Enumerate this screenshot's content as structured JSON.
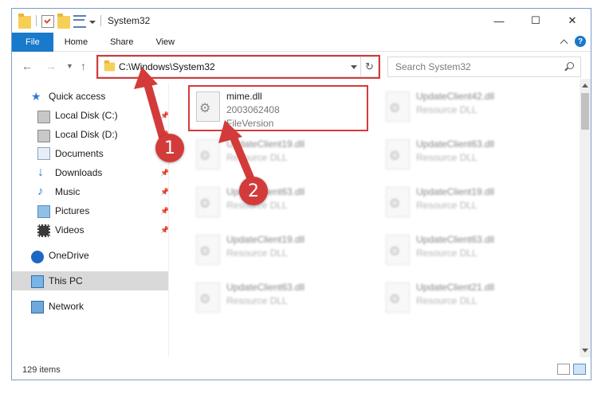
{
  "window": {
    "title": "System32",
    "controls": {
      "minimize": "—",
      "maximize": "☐",
      "close": "✕"
    }
  },
  "ribbon": {
    "tabs": [
      "File",
      "Home",
      "Share",
      "View"
    ],
    "help": "?"
  },
  "address": {
    "path": "C:\\Windows\\System32",
    "refresh_icon": "↻"
  },
  "search": {
    "placeholder": "Search System32"
  },
  "nav": {
    "items": [
      {
        "label": "Quick access",
        "icon": "star-icon",
        "pinned": false
      },
      {
        "label": "Local Disk (C:)",
        "icon": "disk-icon",
        "pinned": true
      },
      {
        "label": "Local Disk (D:)",
        "icon": "disk-icon",
        "pinned": true
      },
      {
        "label": "Documents",
        "icon": "document-icon",
        "pinned": true
      },
      {
        "label": "Downloads",
        "icon": "download-icon",
        "pinned": true
      },
      {
        "label": "Music",
        "icon": "music-icon",
        "pinned": true
      },
      {
        "label": "Pictures",
        "icon": "pictures-icon",
        "pinned": true
      },
      {
        "label": "Videos",
        "icon": "video-icon",
        "pinned": true
      },
      {
        "label": "OneDrive",
        "icon": "cloud-icon",
        "pinned": false
      },
      {
        "label": "This PC",
        "icon": "computer-icon",
        "pinned": false,
        "selected": true
      },
      {
        "label": "Network",
        "icon": "network-icon",
        "pinned": false
      }
    ]
  },
  "files": [
    {
      "name": "mime.dll",
      "line2": "2003062408",
      "line3": "FileVersion",
      "highlighted": true
    },
    {
      "name": "UpdateClient42.dll",
      "line2": "Resource DLL"
    },
    {
      "name": "UpdateClient19.dll",
      "line2": "Resource DLL"
    },
    {
      "name": "UpdateClient63.dll",
      "line2": "Resource DLL"
    },
    {
      "name": "UpdateClient63.dll",
      "line2": "Resource DLL"
    },
    {
      "name": "UpdateClient19.dll",
      "line2": "Resource DLL"
    },
    {
      "name": "UpdateClient19.dll",
      "line2": "Resource DLL"
    },
    {
      "name": "UpdateClient63.dll",
      "line2": "Resource DLL"
    },
    {
      "name": "UpdateClient63.dll",
      "line2": "Resource DLL"
    },
    {
      "name": "UpdateClient21.dll",
      "line2": "Resource DLL"
    }
  ],
  "status": {
    "item_count": "129 items"
  },
  "callouts": {
    "step1": "1",
    "step2": "2"
  },
  "colors": {
    "highlight": "#d53a3a",
    "accent": "#1979ca"
  }
}
